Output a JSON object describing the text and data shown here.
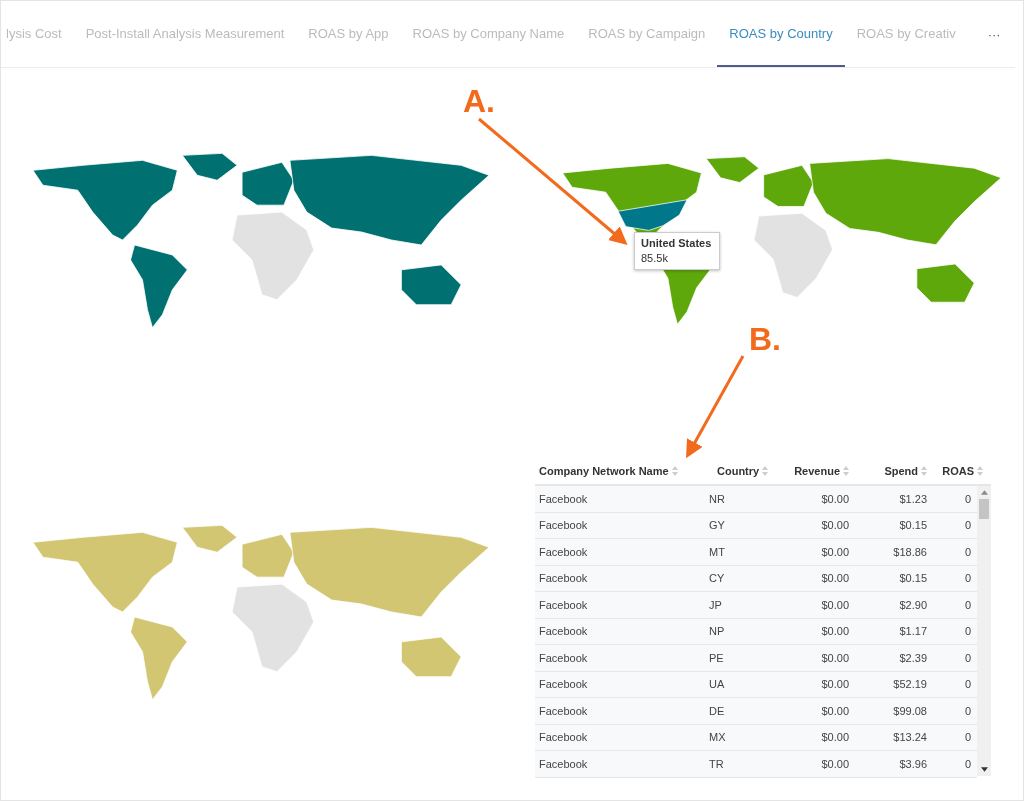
{
  "tabs": [
    {
      "label": "lysis Cost",
      "selected": false
    },
    {
      "label": "Post-Install Analysis Measurement",
      "selected": false
    },
    {
      "label": "ROAS by App",
      "selected": false
    },
    {
      "label": "ROAS by Company Name",
      "selected": false
    },
    {
      "label": "ROAS by Campaign",
      "selected": false
    },
    {
      "label": "ROAS by Country",
      "selected": true
    },
    {
      "label": "ROAS by Creativ",
      "selected": false
    }
  ],
  "more_button": "···",
  "maps": [
    {
      "color": "#007070"
    },
    {
      "color": "#5fa80c",
      "highlighted_country": {
        "color": "#00778a"
      },
      "tooltip": {
        "title": "United States",
        "value": "85.5k"
      }
    },
    {
      "color": "#d2c673"
    }
  ],
  "table": {
    "columns": [
      "Company Network Name",
      "Country",
      "Revenue",
      "Spend",
      "ROAS"
    ],
    "rows": [
      [
        "Facebook",
        "NR",
        "$0.00",
        "$1.23",
        "0"
      ],
      [
        "Facebook",
        "GY",
        "$0.00",
        "$0.15",
        "0"
      ],
      [
        "Facebook",
        "MT",
        "$0.00",
        "$18.86",
        "0"
      ],
      [
        "Facebook",
        "CY",
        "$0.00",
        "$0.15",
        "0"
      ],
      [
        "Facebook",
        "JP",
        "$0.00",
        "$2.90",
        "0"
      ],
      [
        "Facebook",
        "NP",
        "$0.00",
        "$1.17",
        "0"
      ],
      [
        "Facebook",
        "PE",
        "$0.00",
        "$2.39",
        "0"
      ],
      [
        "Facebook",
        "UA",
        "$0.00",
        "$52.19",
        "0"
      ],
      [
        "Facebook",
        "DE",
        "$0.00",
        "$99.08",
        "0"
      ],
      [
        "Facebook",
        "MX",
        "$0.00",
        "$13.24",
        "0"
      ],
      [
        "Facebook",
        "TR",
        "$0.00",
        "$3.96",
        "0"
      ]
    ]
  },
  "annotations": [
    {
      "label": "A."
    },
    {
      "label": "B."
    }
  ]
}
